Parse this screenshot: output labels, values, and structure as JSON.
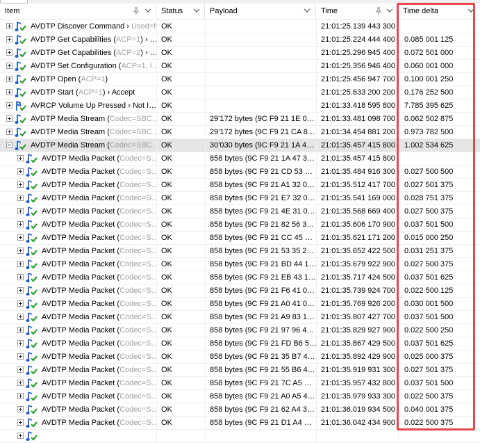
{
  "columns": {
    "item": "Item",
    "status": "Status",
    "payload": "Payload",
    "time": "Time",
    "time_delta": "Time delta"
  },
  "colors": {
    "highlight_border": "#e8474f",
    "selected_row": "#e5e5e5",
    "icon_green": "#2e9e2e",
    "icon_blue": "#1f5fbf"
  },
  "rows": [
    {
      "expand": "plus",
      "level": 0,
      "icon": "audio-note-icon",
      "name": "AVDTP Discover Command",
      "sep": " › ",
      "extra": "Used=N…",
      "status": "OK",
      "payload": "",
      "time": "21:01:25.139 443 300",
      "delta": ""
    },
    {
      "expand": "plus",
      "level": 0,
      "icon": "audio-note-icon",
      "name": "AVDTP Get Capabilities",
      "sep": " (",
      "extra": "ACP=1",
      "extra2": ") › …",
      "status": "OK",
      "payload": "",
      "time": "21:01:25.224 444 400",
      "delta": "0.085 001 125"
    },
    {
      "expand": "plus",
      "level": 0,
      "icon": "audio-note-icon",
      "name": "AVDTP Get Capabilities",
      "sep": " (",
      "extra": "ACP=2",
      "extra2": ") › …",
      "status": "OK",
      "payload": "",
      "time": "21:01:25.296 945 400",
      "delta": "0.072 501 000"
    },
    {
      "expand": "plus",
      "level": 0,
      "icon": "audio-note-icon",
      "name": "AVDTP Set Configuration",
      "sep": " (",
      "extra": "ACP=1, I…",
      "extra2": "",
      "status": "OK",
      "payload": "",
      "time": "21:01:25.356 946 400",
      "delta": "0.060 001 000"
    },
    {
      "expand": "plus",
      "level": 0,
      "icon": "audio-note-icon",
      "name": "AVDTP Open",
      "sep": " (",
      "extra": "ACP=1",
      "extra2": ")",
      "status": "OK",
      "payload": "",
      "time": "21:01:25.456 947 700",
      "delta": "0.100 001 250"
    },
    {
      "expand": "plus",
      "level": 0,
      "icon": "audio-note-icon",
      "name": "AVDTP Start",
      "sep": " (",
      "extra": "ACP=1",
      "extra2": ") › Accept",
      "status": "OK",
      "payload": "",
      "time": "21:01:25.633 200 200",
      "delta": "0.176 252 500"
    },
    {
      "expand": "plus",
      "level": 0,
      "icon": "avrcp-remote-icon",
      "name": "AVRCP Volume Up Pressed",
      "sep": " › ",
      "extra": "",
      "extra2": "Not I…",
      "status": "OK",
      "payload": "",
      "time": "21:01:33.418 595 800",
      "delta": "7.785 395 625"
    },
    {
      "expand": "plus",
      "level": 0,
      "icon": "audio-note-icon",
      "name": "AVDTP Media Stream",
      "sep": " (",
      "extra": "Codec=SBC…",
      "extra2": "",
      "status": "OK",
      "payload": "29'172 bytes (9C F9 21 1E 0…",
      "time": "21:01:33.481 098 700",
      "delta": "0.062 502 875"
    },
    {
      "expand": "plus",
      "level": 0,
      "icon": "audio-note-icon",
      "name": "AVDTP Media Stream",
      "sep": " (",
      "extra": "Codec=SBC…",
      "extra2": "",
      "status": "OK",
      "payload": "29'172 bytes (9C F9 21 CA 8…",
      "time": "21:01:34.454 881 200",
      "delta": "0.973 782 500"
    },
    {
      "expand": "minus",
      "level": 0,
      "selected": true,
      "icon": "audio-note-icon",
      "name": "AVDTP Media Stream",
      "sep": " (",
      "extra": "Codec=SBC…",
      "extra2": "",
      "status": "OK",
      "payload": "30'030 bytes (9C F9 21 1A 4…",
      "time": "21:01:35.457 415 800",
      "delta": "1.002 534 625"
    },
    {
      "expand": "plus",
      "level": 1,
      "icon": "audio-note-icon",
      "name": "AVDTP Media Packet",
      "sep": " (",
      "extra": "Codec=S…",
      "extra2": "",
      "status": "OK",
      "payload": "858 bytes (9C F9 21 1A 47 3…",
      "time": "21:01:35.457 415 800",
      "delta": ""
    },
    {
      "expand": "plus",
      "level": 1,
      "icon": "audio-note-icon",
      "name": "AVDTP Media Packet",
      "sep": " (",
      "extra": "Codec=S…",
      "extra2": "",
      "status": "OK",
      "payload": "858 bytes (9C F9 21 CD 53 …",
      "time": "21:01:35.484 916 300",
      "delta": "0.027 500 500"
    },
    {
      "expand": "plus",
      "level": 1,
      "icon": "audio-note-icon",
      "name": "AVDTP Media Packet",
      "sep": " (",
      "extra": "Codec=S…",
      "extra2": "",
      "status": "OK",
      "payload": "858 bytes (9C F9 21 A1 32 0…",
      "time": "21:01:35.512 417 700",
      "delta": "0.027 501 375"
    },
    {
      "expand": "plus",
      "level": 1,
      "icon": "audio-note-icon",
      "name": "AVDTP Media Packet",
      "sep": " (",
      "extra": "Codec=S…",
      "extra2": "",
      "status": "OK",
      "payload": "858 bytes (9C F9 21 E7 32 0…",
      "time": "21:01:35.541 169 000",
      "delta": "0.028 751 375"
    },
    {
      "expand": "plus",
      "level": 1,
      "icon": "audio-note-icon",
      "name": "AVDTP Media Packet",
      "sep": " (",
      "extra": "Codec=S…",
      "extra2": "",
      "status": "OK",
      "payload": "858 bytes (9C F9 21 4E 31 0…",
      "time": "21:01:35.568 669 400",
      "delta": "0.027 500 375"
    },
    {
      "expand": "plus",
      "level": 1,
      "icon": "audio-note-icon",
      "name": "AVDTP Media Packet",
      "sep": " (",
      "extra": "Codec=S…",
      "extra2": "",
      "status": "OK",
      "payload": "858 bytes (9C F9 21 82 56 3…",
      "time": "21:01:35.606 170 900",
      "delta": "0.037 501 500"
    },
    {
      "expand": "plus",
      "level": 1,
      "icon": "audio-note-icon",
      "name": "AVDTP Media Packet",
      "sep": " (",
      "extra": "Codec=S…",
      "extra2": "",
      "status": "OK",
      "payload": "858 bytes (9C F9 21 CC 45 …",
      "time": "21:01:35.621 171 200",
      "delta": "0.015 000 250"
    },
    {
      "expand": "plus",
      "level": 1,
      "icon": "audio-note-icon",
      "name": "AVDTP Media Packet",
      "sep": " (",
      "extra": "Codec=S…",
      "extra2": "",
      "status": "OK",
      "payload": "858 bytes (9C F9 21 53 35 2…",
      "time": "21:01:35.652 422 500",
      "delta": "0.031 251 375"
    },
    {
      "expand": "plus",
      "level": 1,
      "icon": "audio-note-icon",
      "name": "AVDTP Media Packet",
      "sep": " (",
      "extra": "Codec=S…",
      "extra2": "",
      "status": "OK",
      "payload": "858 bytes (9C F9 21 BD 44 1…",
      "time": "21:01:35.679 922 900",
      "delta": "0.027 500 375"
    },
    {
      "expand": "plus",
      "level": 1,
      "icon": "audio-note-icon",
      "name": "AVDTP Media Packet",
      "sep": " (",
      "extra": "Codec=S…",
      "extra2": "",
      "status": "OK",
      "payload": "858 bytes (9C F9 21 EB 43 1…",
      "time": "21:01:35.717 424 500",
      "delta": "0.037 501 625"
    },
    {
      "expand": "plus",
      "level": 1,
      "icon": "audio-note-icon",
      "name": "AVDTP Media Packet",
      "sep": " (",
      "extra": "Codec=S…",
      "extra2": "",
      "status": "OK",
      "payload": "858 bytes (9C F9 21 F6 41 0…",
      "time": "21:01:35.739 924 700",
      "delta": "0.022 500 125"
    },
    {
      "expand": "plus",
      "level": 1,
      "icon": "audio-note-icon",
      "name": "AVDTP Media Packet",
      "sep": " (",
      "extra": "Codec=S…",
      "extra2": "",
      "status": "OK",
      "payload": "858 bytes (9C F9 21 A0 41 0…",
      "time": "21:01:35.769 926 200",
      "delta": "0.030 001 500"
    },
    {
      "expand": "plus",
      "level": 1,
      "icon": "audio-note-icon",
      "name": "AVDTP Media Packet",
      "sep": " (",
      "extra": "Codec=S…",
      "extra2": "",
      "status": "OK",
      "payload": "858 bytes (9C F9 21 A9 83 1…",
      "time": "21:01:35.807 427 700",
      "delta": "0.037 501 500"
    },
    {
      "expand": "plus",
      "level": 1,
      "icon": "audio-note-icon",
      "name": "AVDTP Media Packet",
      "sep": " (",
      "extra": "Codec=S…",
      "extra2": "",
      "status": "OK",
      "payload": "858 bytes (9C F9 21 97 96 4…",
      "time": "21:01:35.829 927 900",
      "delta": "0.022 500 250"
    },
    {
      "expand": "plus",
      "level": 1,
      "icon": "audio-note-icon",
      "name": "AVDTP Media Packet",
      "sep": " (",
      "extra": "Codec=S…",
      "extra2": "",
      "status": "OK",
      "payload": "858 bytes (9C F9 21 FD B6 5…",
      "time": "21:01:35.867 429 500",
      "delta": "0.037 501 625"
    },
    {
      "expand": "plus",
      "level": 1,
      "icon": "audio-note-icon",
      "name": "AVDTP Media Packet",
      "sep": " (",
      "extra": "Codec=S…",
      "extra2": "",
      "status": "OK",
      "payload": "858 bytes (9C F9 21 35 B7 4…",
      "time": "21:01:35.892 429 900",
      "delta": "0.025 000 375"
    },
    {
      "expand": "plus",
      "level": 1,
      "icon": "audio-note-icon",
      "name": "AVDTP Media Packet",
      "sep": " (",
      "extra": "Codec=S…",
      "extra2": "",
      "status": "OK",
      "payload": "858 bytes (9C F9 21 55 B6 4…",
      "time": "21:01:35.919 931 300",
      "delta": "0.027 501 375"
    },
    {
      "expand": "plus",
      "level": 1,
      "icon": "audio-note-icon",
      "name": "AVDTP Media Packet",
      "sep": " (",
      "extra": "Codec=S…",
      "extra2": "",
      "status": "OK",
      "payload": "858 bytes (9C F9 21 7C A5 …",
      "time": "21:01:35.957 432 800",
      "delta": "0.037 501 500"
    },
    {
      "expand": "plus",
      "level": 1,
      "icon": "audio-note-icon",
      "name": "AVDTP Media Packet",
      "sep": " (",
      "extra": "Codec=S…",
      "extra2": "",
      "status": "OK",
      "payload": "858 bytes (9C F9 21 A0 A5 4…",
      "time": "21:01:35.979 933 300",
      "delta": "0.022 500 375"
    },
    {
      "expand": "plus",
      "level": 1,
      "icon": "audio-note-icon",
      "name": "AVDTP Media Packet",
      "sep": " (",
      "extra": "Codec=S…",
      "extra2": "",
      "status": "OK",
      "payload": "858 bytes (9C F9 21 62 A4 3…",
      "time": "21:01:36.019 934 500",
      "delta": "0.040 001 375"
    },
    {
      "expand": "plus",
      "level": 1,
      "icon": "audio-note-icon",
      "name": "AVDTP Media Packet",
      "sep": " (",
      "extra": "Codec=S…",
      "extra2": "",
      "status": "OK",
      "payload": "858 bytes (9C F9 21 D1 A4 …",
      "time": "21:01:36.042 434 900",
      "delta": "0.022 500 375"
    },
    {
      "expand": "plus",
      "level": 1,
      "partial": true,
      "icon": "audio-note-icon",
      "name": "",
      "sep": "",
      "extra": "",
      "extra2": "",
      "status": "",
      "payload": "",
      "time": "",
      "delta": ""
    }
  ]
}
